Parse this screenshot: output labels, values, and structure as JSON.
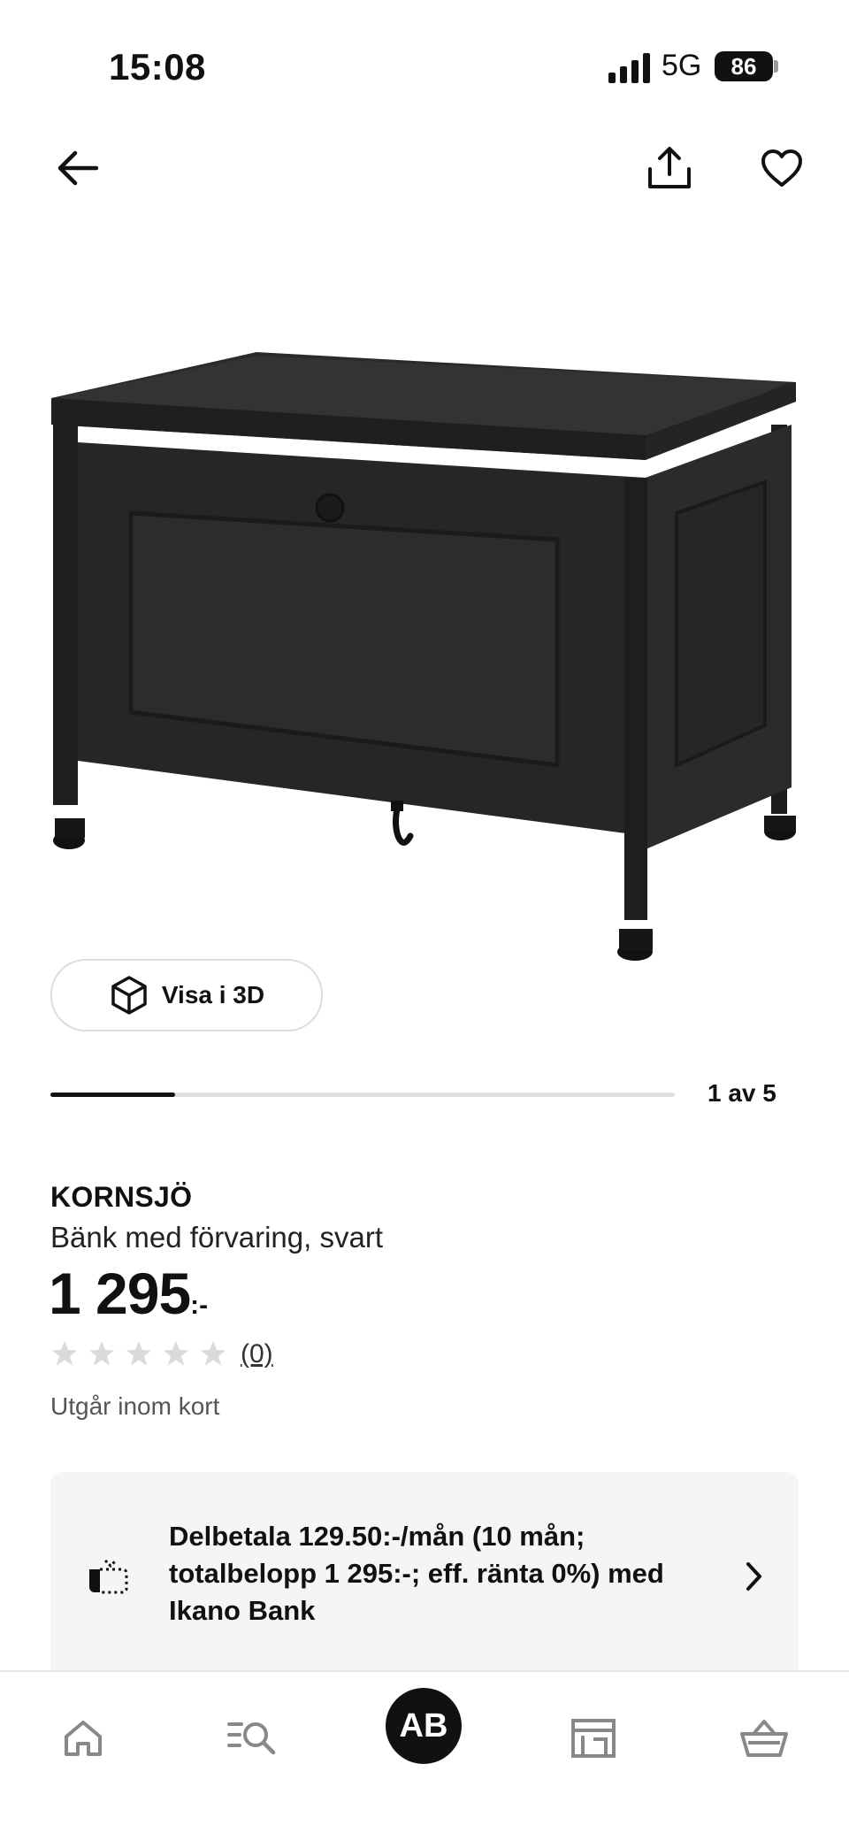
{
  "status_bar": {
    "time": "15:08",
    "network": "5G",
    "battery": "86"
  },
  "top_nav": {
    "back_icon": "arrow-left-icon",
    "share_icon": "share-icon",
    "favorite_icon": "heart-icon"
  },
  "gallery": {
    "view_3d_label": "Visa i 3D",
    "counter": "1 av 5",
    "current": 1,
    "total": 5
  },
  "product": {
    "brand": "KORNSJÖ",
    "description": "Bänk med förvaring, svart",
    "price": "1 295",
    "price_suffix": ":-",
    "rating": 0,
    "rating_count": "(0)",
    "note": "Utgår inom kort"
  },
  "financing": {
    "text": "Delbetala 129.50:-/mån (10 mån; totalbelopp 1 295:-; eff. ränta 0%) med Ikano Bank",
    "icon": "installment-icon"
  },
  "bottom_nav": {
    "items": [
      "home-icon",
      "search-list-icon",
      "avatar",
      "store-icon",
      "basket-icon"
    ],
    "avatar_initials": "AB"
  },
  "colors": {
    "primary_text": "#111111",
    "muted_text": "#555555",
    "card_bg": "#f5f5f5",
    "star_empty": "#dadada"
  }
}
